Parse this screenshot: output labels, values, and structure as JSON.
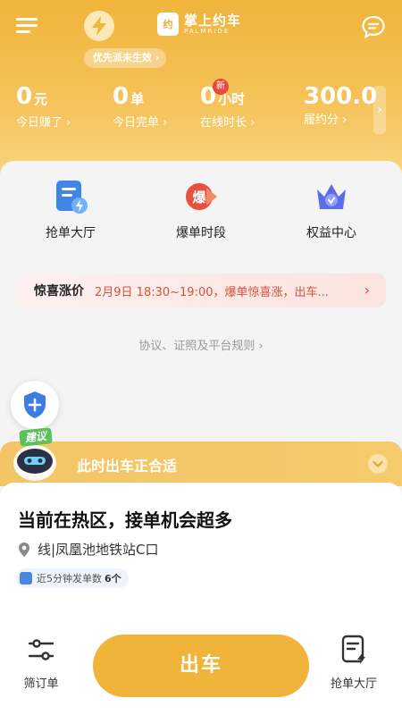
{
  "header": {
    "logo_badge": "约",
    "logo_name": "掌上约车",
    "logo_sub": "PALMRIDE",
    "priority_pill": "优先派未生效"
  },
  "stats": [
    {
      "value": "0",
      "unit": "元",
      "label": "今日赚了"
    },
    {
      "value": "0",
      "unit": "单",
      "label": "今日完单"
    },
    {
      "value": "0",
      "unit": "小时",
      "label": "在线时长",
      "badge": "新"
    },
    {
      "value": "300.0",
      "unit": "",
      "label": "履约分"
    }
  ],
  "quick_actions": [
    {
      "label": "抢单大厅",
      "icon": "order-hall-icon"
    },
    {
      "label": "爆单时段",
      "icon": "burst-icon"
    },
    {
      "label": "权益中心",
      "icon": "crown-icon"
    }
  ],
  "promo": {
    "title": "惊喜涨价",
    "text": "2月9日 18:30~19:00，爆单惊喜涨，出车..."
  },
  "rules_link": "协议、证照及平台规则 ›",
  "suggest": {
    "tag": "建议",
    "text": "此时出车正合适"
  },
  "hot_card": {
    "title": "当前在热区，接单机会超多",
    "location": "线|凤凰池地铁站C口",
    "badge_label": "近5分钟发单数",
    "badge_count": "6个"
  },
  "bottom_bar": {
    "filter_label": "筛订单",
    "go_label": "出车",
    "hall_label": "抢单大厅"
  },
  "colors": {
    "brand": "#f0b43a",
    "promo_red": "#d9503a",
    "shield_blue": "#3b7de4"
  }
}
